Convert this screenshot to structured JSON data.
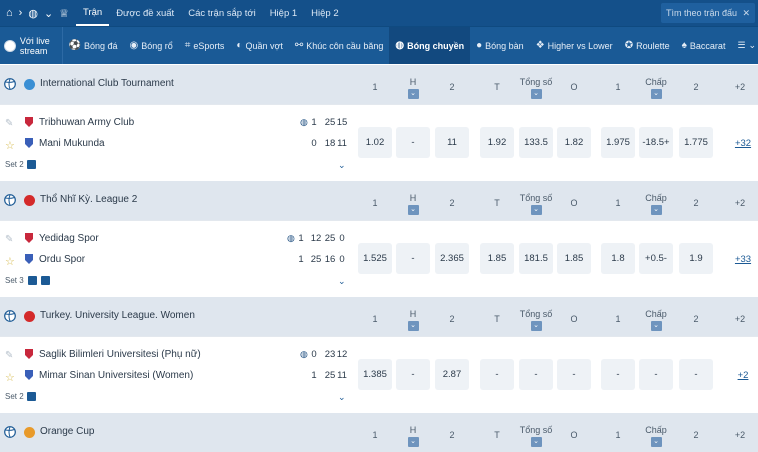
{
  "topbar": {
    "tabs": [
      {
        "label": "Trận",
        "active": true
      },
      {
        "label": "Được đề xuất"
      },
      {
        "label": "Các trận sắp tới"
      },
      {
        "label": "Hiệp 1"
      },
      {
        "label": "Hiệp 2"
      }
    ],
    "search_placeholder": "Tìm theo trận đấu"
  },
  "sportbar": {
    "live_stream": "Với live stream",
    "sports": [
      {
        "label": "Bóng đá",
        "icon": "soccer-icon"
      },
      {
        "label": "Bóng rổ",
        "icon": "basketball-icon"
      },
      {
        "label": "eSports",
        "icon": "esports-icon"
      },
      {
        "label": "Quần vợt",
        "icon": "tennis-icon"
      },
      {
        "label": "Khúc côn cầu băng",
        "icon": "hockey-icon"
      },
      {
        "label": "Bóng chuyền",
        "icon": "volleyball-icon",
        "active": true
      },
      {
        "label": "Bóng bàn",
        "icon": "table-tennis-icon"
      },
      {
        "label": "Higher vs Lower",
        "icon": "cards-icon"
      },
      {
        "label": "Roulette",
        "icon": "roulette-icon"
      },
      {
        "label": "Baccarat",
        "icon": "baccarat-icon"
      }
    ]
  },
  "headers": {
    "h1": "1",
    "hx": "H",
    "h2": "2",
    "ht": "T",
    "total": "Tổng số",
    "o": "O",
    "c1": "1",
    "hcap": "Chấp",
    "c2": "2"
  },
  "leagues": [
    {
      "name": "International Club Tournament",
      "more": "+2",
      "match": {
        "team1": "Tribhuwan Army Club",
        "team2": "Mani Mukunda",
        "score1": [
          "1",
          "25",
          "15"
        ],
        "score2": [
          "0",
          "18",
          "11"
        ],
        "serving": 1,
        "set": "Set 2",
        "odds": [
          "1.02",
          "-",
          "11",
          "1.92",
          "133.5",
          "1.82",
          "1.975",
          "-18.5+",
          "1.775"
        ],
        "more": "+32"
      }
    },
    {
      "name": "Thổ Nhĩ Kỳ. League 2",
      "more": "+2",
      "match": {
        "team1": "Yedidag Spor",
        "team2": "Ordu Spor",
        "score1": [
          "1",
          "12",
          "25",
          "0"
        ],
        "score2": [
          "1",
          "25",
          "16",
          "0"
        ],
        "serving": 1,
        "set": "Set 3",
        "odds": [
          "1.525",
          "-",
          "2.365",
          "1.85",
          "181.5",
          "1.85",
          "1.8",
          "+0.5-",
          "1.9"
        ],
        "more": "+33"
      }
    },
    {
      "name": "Turkey. University League. Women",
      "more": "+2",
      "match": {
        "team1": "Saglik Bilimleri Universitesi (Phụ nữ)",
        "team2": "Mimar Sinan Universitesi (Women)",
        "score1": [
          "0",
          "23",
          "12"
        ],
        "score2": [
          "1",
          "25",
          "11"
        ],
        "serving": 1,
        "set": "Set 2",
        "odds": [
          "1.385",
          "-",
          "2.87",
          "-",
          "-",
          "-",
          "-",
          "-",
          "-"
        ],
        "more": "+2"
      }
    },
    {
      "name": "Orange Cup",
      "more": "+2"
    }
  ],
  "colors": {
    "topbar": "#14508a",
    "sportbar": "#1a5a96",
    "league_row": "#dfe6ee",
    "odds_bg": "#eef2f6"
  }
}
